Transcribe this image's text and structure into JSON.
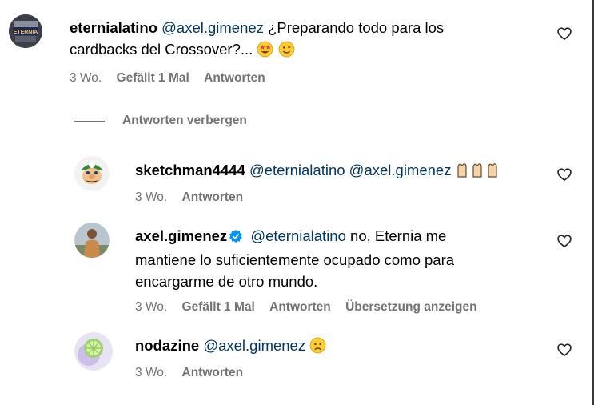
{
  "thread": {
    "hide_replies_label": "Antworten verbergen"
  },
  "comments": [
    {
      "username": "eternialatino",
      "mention": "@axel.gimenez",
      "text_line1": " ¿Preparando todo para los",
      "text_line2": "cardbacks del Crossover?... ",
      "time": "3 Wo.",
      "likes": "Gefällt 1 Mal",
      "reply": "Antworten",
      "avatar_text": "ETERNIA"
    },
    {
      "username": "sketchman4444",
      "mention1": "@eternialatino",
      "mention2": "@axel.gimenez",
      "time": "3 Wo.",
      "reply": "Antworten"
    },
    {
      "username": "axel.gimenez",
      "mention": "@eternialatino",
      "text_line1": " no, Eternia me",
      "text_line2": "mantiene lo suficientemente ocupado como para",
      "text_line3": "encargarme de otro mundo.",
      "time": "3 Wo.",
      "likes": "Gefällt 1 Mal",
      "reply": "Antworten",
      "translate": "Übersetzung anzeigen"
    },
    {
      "username": "nodazine",
      "mention": "@axel.gimenez",
      "time": "3 Wo.",
      "reply": "Antworten"
    }
  ],
  "colors": {
    "mention": "#00376b",
    "meta": "#737373",
    "verified": "#0095f6"
  },
  "icons": [
    "heart-icon",
    "verified-badge-icon",
    "star-struck-emoji",
    "wink-emoji",
    "clapping-hands-emoji",
    "sad-emoji"
  ]
}
